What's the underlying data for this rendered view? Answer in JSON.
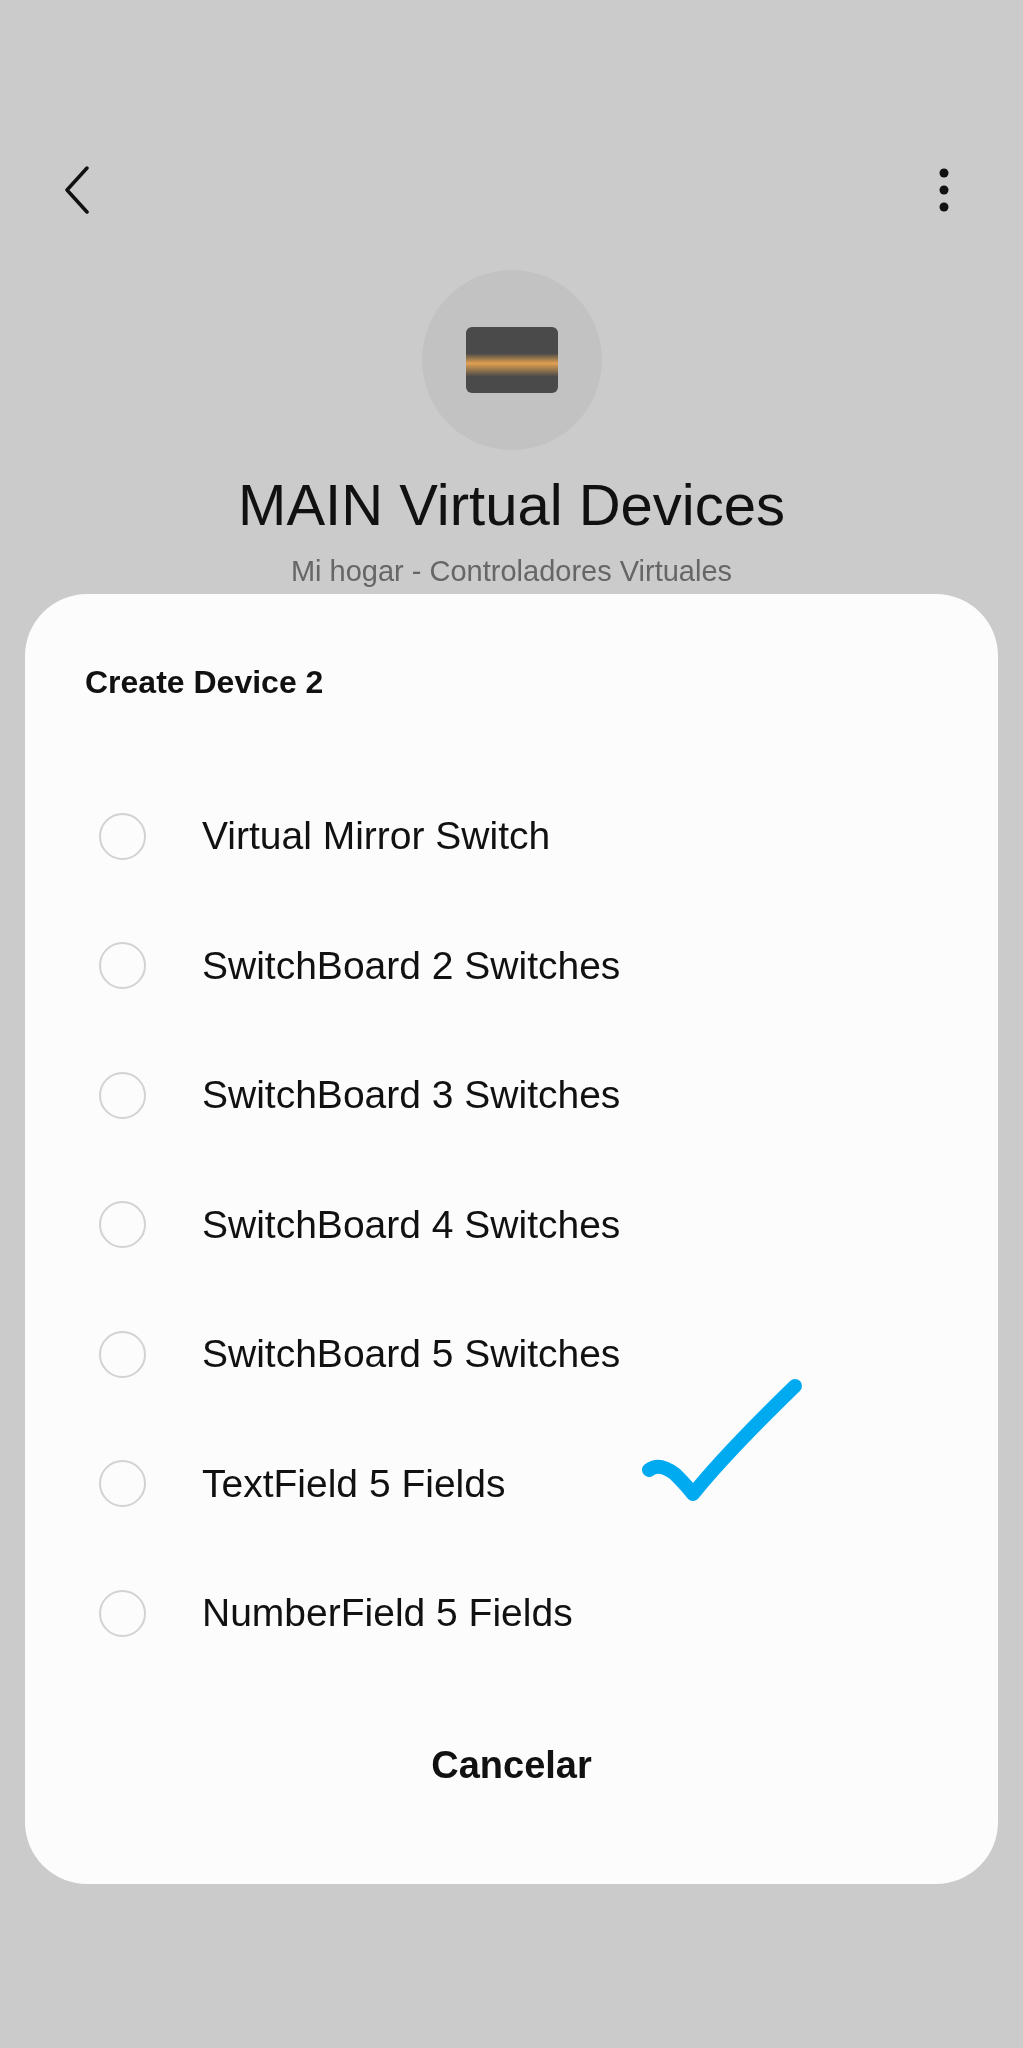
{
  "header": {
    "title": "MAIN Virtual Devices",
    "subtitle": "Mi hogar - Controladores Virtuales"
  },
  "dialog": {
    "title": "Create Device 2",
    "options": [
      {
        "label": "Virtual Mirror Switch",
        "selected": false
      },
      {
        "label": "SwitchBoard 2 Switches",
        "selected": false
      },
      {
        "label": "SwitchBoard 3 Switches",
        "selected": false
      },
      {
        "label": "SwitchBoard 4 Switches",
        "selected": false
      },
      {
        "label": "SwitchBoard 5 Switches",
        "selected": false
      },
      {
        "label": "TextField 5 Fields",
        "selected": false
      },
      {
        "label": "NumberField 5 Fields",
        "selected": false
      }
    ],
    "cancel": "Cancelar"
  }
}
